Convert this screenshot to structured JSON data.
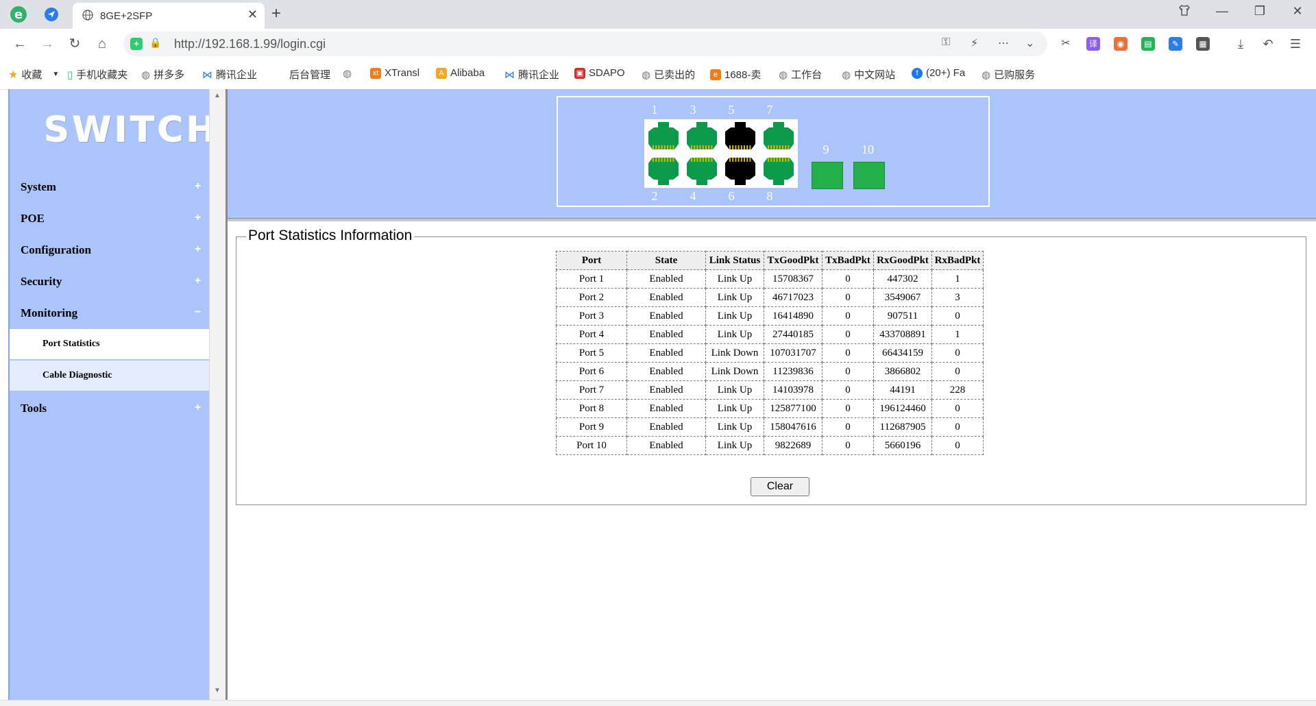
{
  "browser": {
    "tab_title": "8GE+2SFP",
    "url": "http://192.168.1.99/login.cgi",
    "bookmarks": [
      "收藏",
      "手机收藏夹",
      "拼多多",
      "腾讯企业",
      "后台管理",
      "XTransl",
      "Alibaba",
      "腾讯企业",
      "SDAPO",
      "已卖出的",
      "1688-卖",
      "工作台",
      "中文网站",
      "(20+) Fa",
      "已购服务"
    ]
  },
  "sidebar": {
    "logo": "SWITCH",
    "menus": [
      {
        "label": "System",
        "sign": "+"
      },
      {
        "label": "POE",
        "sign": "+"
      },
      {
        "label": "Configuration",
        "sign": "+"
      },
      {
        "label": "Security",
        "sign": "+"
      },
      {
        "label": "Monitoring",
        "sign": "−"
      },
      {
        "label": "Tools",
        "sign": "+"
      }
    ],
    "submenus": [
      {
        "label": "Port Statistics",
        "active": true
      },
      {
        "label": "Cable Diagnostic",
        "active": false
      }
    ]
  },
  "ports": {
    "top": [
      "1",
      "3",
      "5",
      "7"
    ],
    "bottom": [
      "2",
      "4",
      "6",
      "8"
    ],
    "sfp": [
      "9",
      "10"
    ],
    "colors": {
      "up": "#0d9a4a",
      "down": "#000000",
      "sfp": "#23b04a"
    },
    "rj_status": [
      "up",
      "up",
      "down",
      "up"
    ]
  },
  "stats": {
    "legend": "Port Statistics Information",
    "headers": [
      "Port",
      "State",
      "Link Status",
      "TxGoodPkt",
      "TxBadPkt",
      "RxGoodPkt",
      "RxBadPkt"
    ],
    "rows": [
      [
        "Port 1",
        "Enabled",
        "Link Up",
        "15708367",
        "0",
        "447302",
        "1"
      ],
      [
        "Port 2",
        "Enabled",
        "Link Up",
        "46717023",
        "0",
        "3549067",
        "3"
      ],
      [
        "Port 3",
        "Enabled",
        "Link Up",
        "16414890",
        "0",
        "907511",
        "0"
      ],
      [
        "Port 4",
        "Enabled",
        "Link Up",
        "27440185",
        "0",
        "433708891",
        "1"
      ],
      [
        "Port 5",
        "Enabled",
        "Link Down",
        "107031707",
        "0",
        "66434159",
        "0"
      ],
      [
        "Port 6",
        "Enabled",
        "Link Down",
        "11239836",
        "0",
        "3866802",
        "0"
      ],
      [
        "Port 7",
        "Enabled",
        "Link Up",
        "14103978",
        "0",
        "44191",
        "228"
      ],
      [
        "Port 8",
        "Enabled",
        "Link Up",
        "125877100",
        "0",
        "196124460",
        "0"
      ],
      [
        "Port 9",
        "Enabled",
        "Link Up",
        "158047616",
        "0",
        "112687905",
        "0"
      ],
      [
        "Port 10",
        "Enabled",
        "Link Up",
        "9822689",
        "0",
        "5660196",
        "0"
      ]
    ],
    "clear_label": "Clear"
  }
}
